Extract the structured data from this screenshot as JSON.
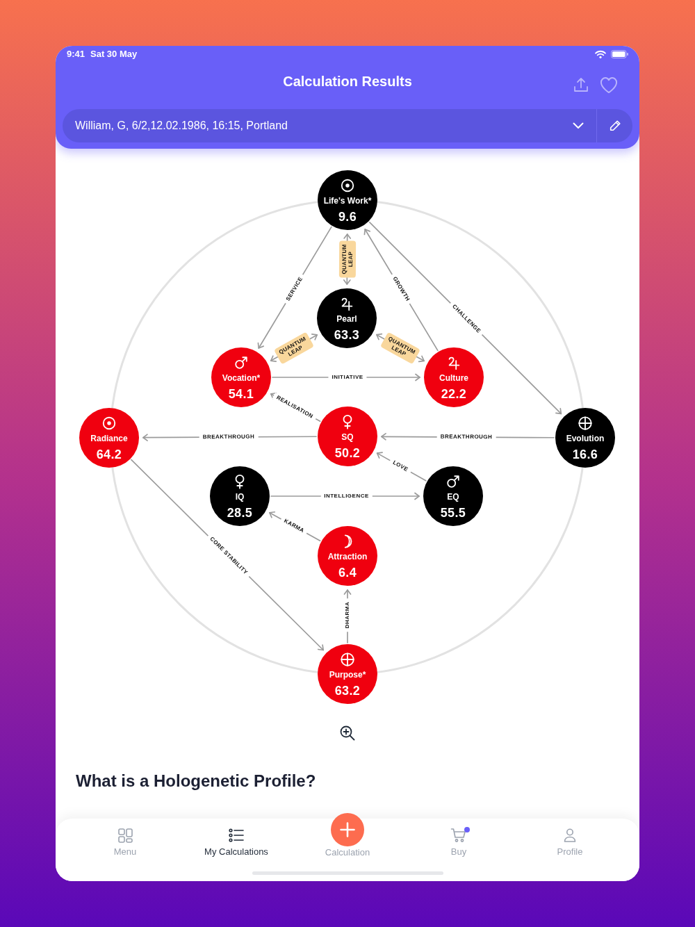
{
  "status_bar": {
    "time": "9:41",
    "date": "Sat 30 May"
  },
  "header": {
    "title": "Calculation Results"
  },
  "profile_selector": {
    "value": "William, G, 6/2,12.02.1986, 16:15, Portland"
  },
  "diagram": {
    "nodes": [
      {
        "label": "Life's Work*",
        "value": "9.6",
        "color": "#000000"
      },
      {
        "label": "Pearl",
        "value": "63.3",
        "color": "#000000"
      },
      {
        "label": "Vocation*",
        "value": "54.1",
        "color": "#f0000f"
      },
      {
        "label": "Culture",
        "value": "22.2",
        "color": "#f0000f"
      },
      {
        "label": "Radiance",
        "value": "64.2",
        "color": "#f0000f"
      },
      {
        "label": "SQ",
        "value": "50.2",
        "color": "#f0000f"
      },
      {
        "label": "Evolution",
        "value": "16.6",
        "color": "#000000"
      },
      {
        "label": "IQ",
        "value": "28.5",
        "color": "#000000"
      },
      {
        "label": "EQ",
        "value": "55.5",
        "color": "#000000"
      },
      {
        "label": "Attraction",
        "value": "6.4",
        "color": "#f0000f"
      },
      {
        "label": "Purpose*",
        "value": "63.2",
        "color": "#f0000f"
      }
    ],
    "edges": [
      {
        "label": "SERVICE",
        "kind": "one-way"
      },
      {
        "label": "QUANTUM LEAP",
        "kind": "two-way"
      },
      {
        "label": "GROWTH",
        "kind": "one-way"
      },
      {
        "label": "CHALLENGE",
        "kind": "one-way"
      },
      {
        "label": "QUANTUM LEAP",
        "kind": "two-way"
      },
      {
        "label": "QUANTUM LEAP",
        "kind": "two-way"
      },
      {
        "label": "INITIATIVE",
        "kind": "one-way"
      },
      {
        "label": "REALISATION",
        "kind": "one-way"
      },
      {
        "label": "BREAKTHROUGH",
        "kind": "one-way"
      },
      {
        "label": "BREAKTHROUGH",
        "kind": "one-way"
      },
      {
        "label": "LOVE",
        "kind": "one-way"
      },
      {
        "label": "INTELLIGENCE",
        "kind": "one-way"
      },
      {
        "label": "KARMA",
        "kind": "one-way"
      },
      {
        "label": "CORE STABILITY",
        "kind": "one-way"
      },
      {
        "label": "DHARMA",
        "kind": "one-way"
      }
    ]
  },
  "section_heading": "What is a Hologenetic Profile?",
  "tab_bar": {
    "items": [
      {
        "label": "Menu",
        "selected": false,
        "kind": "tab",
        "badge_dot": false
      },
      {
        "label": "My Calculations",
        "selected": true,
        "kind": "tab",
        "badge_dot": false
      },
      {
        "label": "Calculation",
        "selected": false,
        "kind": "action",
        "badge_dot": false
      },
      {
        "label": "Buy",
        "selected": false,
        "kind": "tab",
        "badge_dot": true
      },
      {
        "label": "Profile",
        "selected": false,
        "kind": "tab",
        "badge_dot": false
      }
    ]
  }
}
